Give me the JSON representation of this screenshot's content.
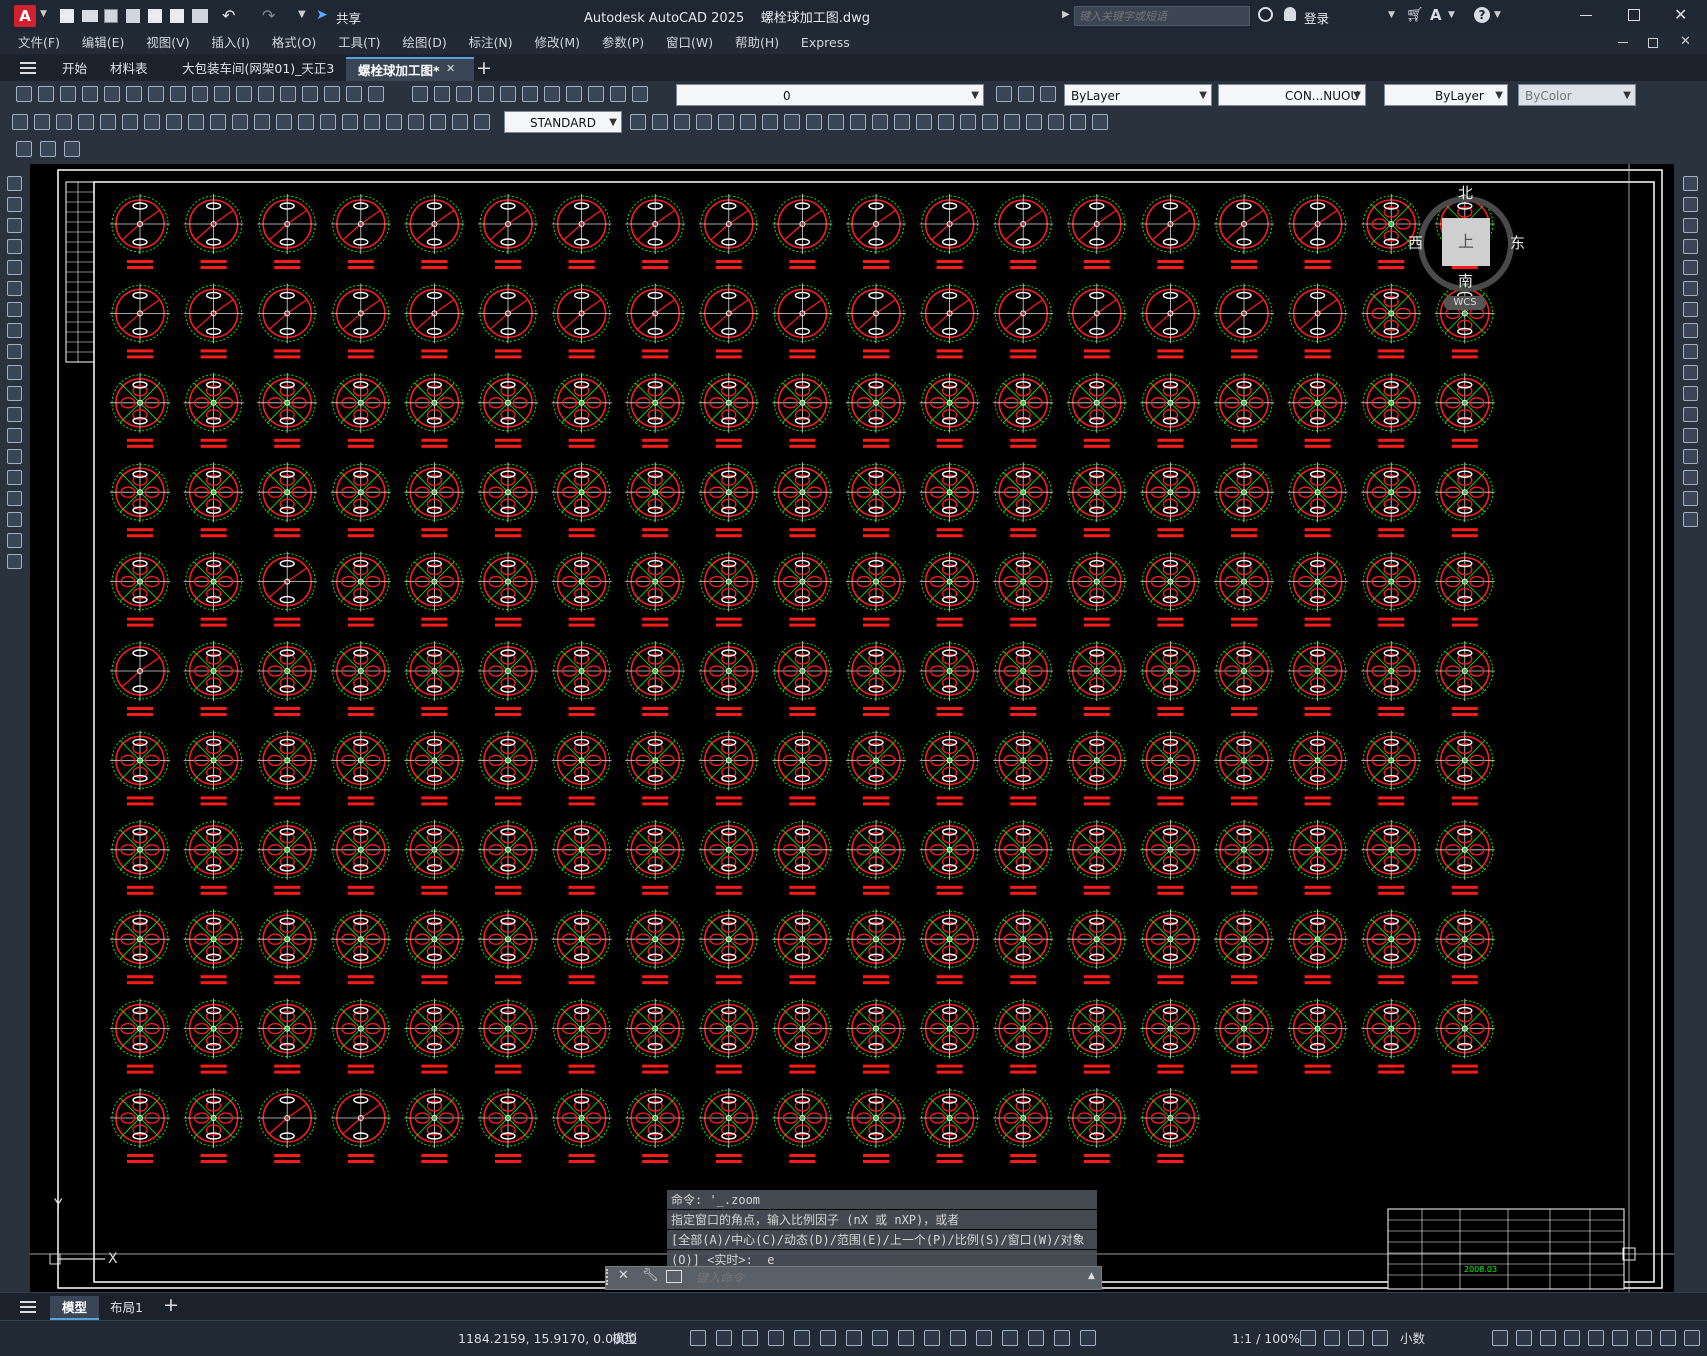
{
  "title": {
    "app": "Autodesk AutoCAD 2025",
    "file": "螺栓球加工图.dwg",
    "share": "共享",
    "search_placeholder": "键入关键字或短语",
    "login": "登录"
  },
  "menu": [
    "文件(F)",
    "编辑(E)",
    "视图(V)",
    "插入(I)",
    "格式(O)",
    "工具(T)",
    "绘图(D)",
    "标注(N)",
    "修改(M)",
    "参数(P)",
    "窗口(W)",
    "帮助(H)",
    "Express"
  ],
  "tabs": [
    {
      "label": "开始"
    },
    {
      "label": "材料表"
    },
    {
      "label": "大包装车间(网架01)_天正3"
    },
    {
      "label": "螺栓球加工图*"
    }
  ],
  "toolbar": {
    "layer_value": "0",
    "color_value": "ByLayer",
    "linetype_value": "CON...NUOU",
    "lineweight_value": "ByLayer",
    "plotstyle_value": "ByColor",
    "textstyle_value": "STANDARD"
  },
  "viewcube": {
    "north": "北",
    "south": "南",
    "east": "东",
    "west": "西",
    "top": "上",
    "wcs": "WCS"
  },
  "command": {
    "history": [
      "命令: '_.zoom",
      "指定窗口的角点，输入比例因子 (nX 或 nXP)，或者",
      "[全部(A)/中心(C)/动态(D)/范围(E)/上一个(P)/比例(S)/窗口(W)/对象",
      "(O)] <实时>: _e"
    ],
    "placeholder": "键入命令"
  },
  "layouts": [
    {
      "label": "模型"
    },
    {
      "label": "布局1"
    }
  ],
  "status": {
    "coords": "1184.2159, 15.9170, 0.0000",
    "space": "模型",
    "scale": "1:1 / 100%",
    "units": "小数"
  },
  "drawing": {
    "title_block_date": "2008.03",
    "colors": {
      "circle": "#ff1a1a",
      "dim": "#00ff00",
      "bolt": "#ffffff",
      "frame": "#ffffff"
    }
  }
}
